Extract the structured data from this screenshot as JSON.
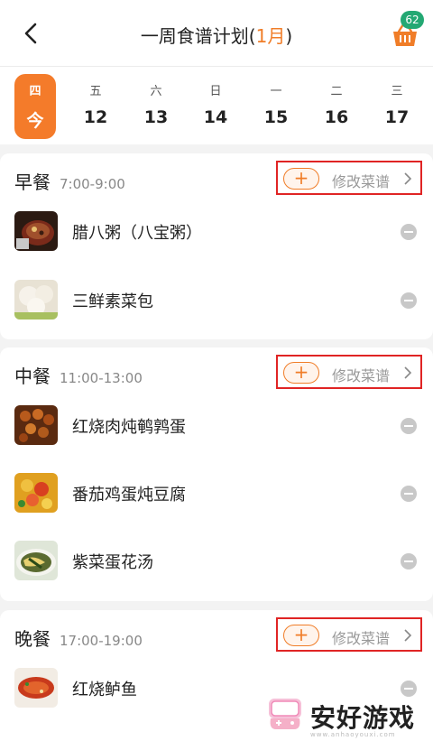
{
  "header": {
    "title_prefix": "一周食谱计划(",
    "title_month": "1月",
    "title_suffix": ")",
    "cart_badge": "62",
    "accent_color": "#f07d28"
  },
  "days": [
    {
      "weekday": "四",
      "date": "今",
      "active": true
    },
    {
      "weekday": "五",
      "date": "12"
    },
    {
      "weekday": "六",
      "date": "13"
    },
    {
      "weekday": "日",
      "date": "14"
    },
    {
      "weekday": "一",
      "date": "15"
    },
    {
      "weekday": "二",
      "date": "16"
    },
    {
      "weekday": "三",
      "date": "17"
    }
  ],
  "meals": [
    {
      "name": "早餐",
      "time": "7:00-9:00",
      "add_label": "+",
      "edit_label": "修改菜谱",
      "items": [
        {
          "name": "腊八粥（八宝粥）",
          "icon": "congee-dish-thumb"
        },
        {
          "name": "三鲜素菜包",
          "icon": "steamed-bun-thumb"
        }
      ]
    },
    {
      "name": "中餐",
      "time": "11:00-13:00",
      "add_label": "+",
      "edit_label": "修改菜谱",
      "items": [
        {
          "name": "红烧肉炖鹌鹑蛋",
          "icon": "braised-pork-thumb"
        },
        {
          "name": "番茄鸡蛋炖豆腐",
          "icon": "tomato-egg-tofu-thumb"
        },
        {
          "name": "紫菜蛋花汤",
          "icon": "seaweed-soup-thumb"
        }
      ]
    },
    {
      "name": "晚餐",
      "time": "17:00-19:00",
      "add_label": "+",
      "edit_label": "修改菜谱",
      "items": [
        {
          "name": "红烧鲈鱼",
          "icon": "braised-fish-thumb"
        }
      ]
    }
  ],
  "watermark": {
    "text": "安好游戏",
    "url": "www.anhaoyouxi.com"
  }
}
